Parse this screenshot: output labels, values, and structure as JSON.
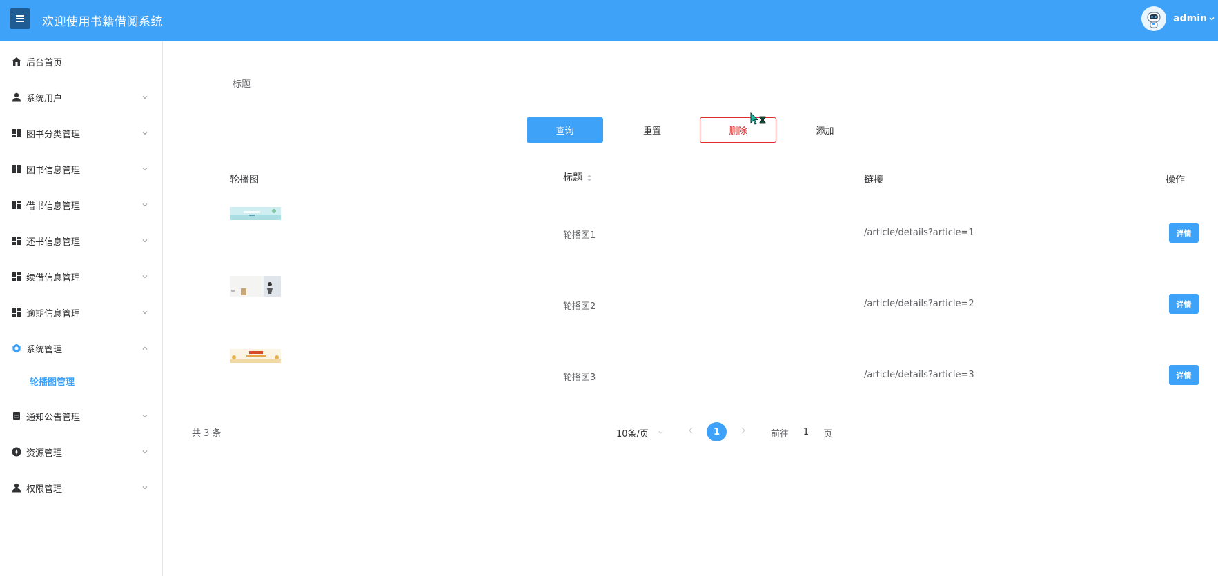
{
  "header": {
    "title": "欢迎使用书籍借阅系统",
    "username": "admin"
  },
  "sidebar": {
    "items": [
      {
        "label": "后台首页",
        "icon": "home-icon"
      },
      {
        "label": "系统用户",
        "icon": "user-icon"
      },
      {
        "label": "图书分类管理",
        "icon": "grid-icon"
      },
      {
        "label": "图书信息管理",
        "icon": "grid-icon"
      },
      {
        "label": "借书信息管理",
        "icon": "grid-icon"
      },
      {
        "label": "还书信息管理",
        "icon": "grid-icon"
      },
      {
        "label": "续借信息管理",
        "icon": "grid-icon"
      },
      {
        "label": "逾期信息管理",
        "icon": "grid-icon"
      },
      {
        "label": "系统管理",
        "icon": "settings-icon"
      },
      {
        "label": "通知公告管理",
        "icon": "document-icon"
      },
      {
        "label": "资源管理",
        "icon": "compass-icon"
      },
      {
        "label": "权限管理",
        "icon": "user-icon"
      }
    ],
    "submenu": {
      "label": "轮播图管理"
    }
  },
  "filter": {
    "title_label": "标题"
  },
  "toolbar": {
    "query": "查询",
    "reset": "重置",
    "delete": "删除",
    "add": "添加"
  },
  "table": {
    "headers": [
      "轮播图",
      "标题",
      "链接",
      "操作"
    ],
    "rows": [
      {
        "title": "轮播图1",
        "link": "/article/details?article=1",
        "action": "详情"
      },
      {
        "title": "轮播图2",
        "link": "/article/details?article=2",
        "action": "详情"
      },
      {
        "title": "轮播图3",
        "link": "/article/details?article=3",
        "action": "详情"
      }
    ]
  },
  "pagination": {
    "total": "共 3 条",
    "page_size": "10条/页",
    "current_page": "1",
    "goto_label": "前往",
    "goto_value": "1",
    "goto_unit": "页"
  },
  "colors": {
    "primary": "#3fa2f9",
    "danger": "#e02b2b",
    "toggle": "#1f5c94"
  }
}
